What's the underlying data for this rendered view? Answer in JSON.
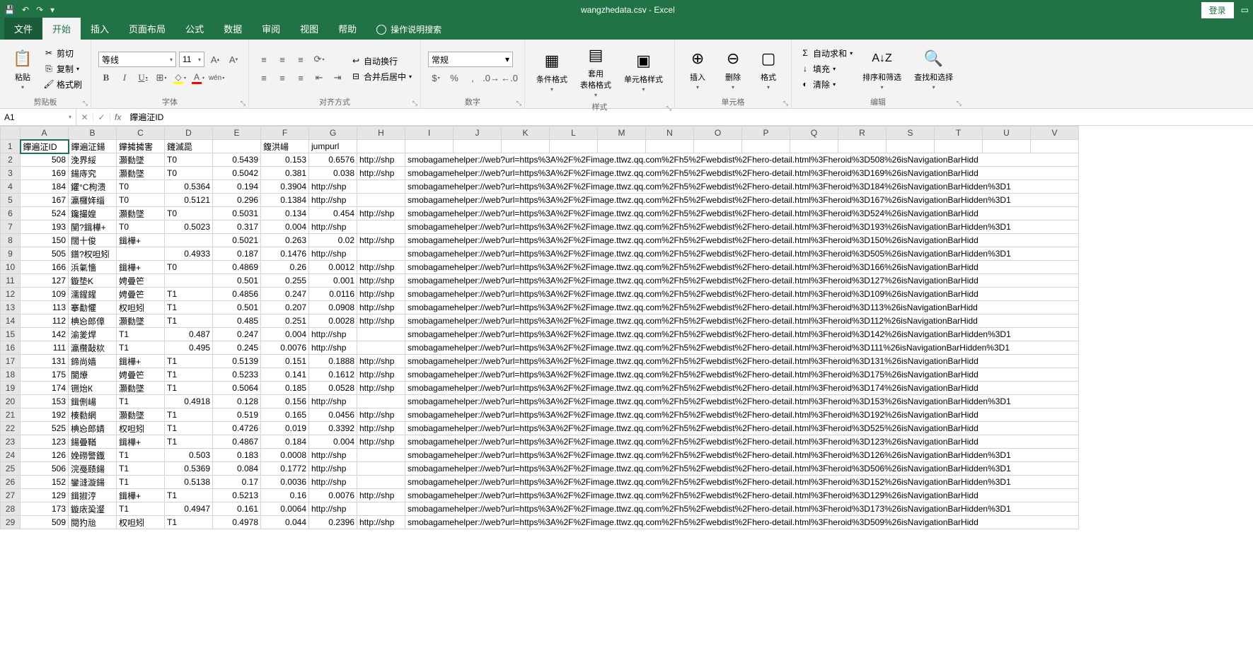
{
  "title": "wangzhedata.csv - Excel",
  "login": "登录",
  "qat": {
    "save": "💾",
    "undo": "↶",
    "redo": "↷",
    "more": "▾"
  },
  "tabs": {
    "file": "文件",
    "home": "开始",
    "insert": "插入",
    "layout": "页面布局",
    "formulas": "公式",
    "data": "数据",
    "review": "审阅",
    "view": "视图",
    "help": "帮助",
    "tellme": "操作说明搜索"
  },
  "ribbon": {
    "clipboard": {
      "label": "剪贴板",
      "paste": "粘贴",
      "cut": "剪切",
      "copy": "复制",
      "painter": "格式刷"
    },
    "font": {
      "label": "字体",
      "name": "等线",
      "size": "11"
    },
    "align": {
      "label": "对齐方式",
      "wrap": "自动换行",
      "merge": "合并后居中"
    },
    "number": {
      "label": "数字",
      "format": "常规"
    },
    "styles": {
      "label": "样式",
      "cond": "条件格式",
      "table": "套用\n表格格式",
      "cell": "单元格样式"
    },
    "cells": {
      "label": "单元格",
      "insert": "插入",
      "delete": "删除",
      "format": "格式"
    },
    "editing": {
      "label": "编辑",
      "sum": "自动求和",
      "fill": "填充",
      "clear": "清除",
      "sort": "排序和筛选",
      "find": "查找和选择"
    }
  },
  "namebox": "A1",
  "formula": "鑻遍泟ID",
  "columns": [
    "A",
    "B",
    "C",
    "D",
    "E",
    "F",
    "G",
    "H",
    "I",
    "J",
    "K",
    "L",
    "M",
    "N",
    "O",
    "P",
    "Q",
    "R",
    "S",
    "T",
    "U",
    "V"
  ],
  "headers": {
    "A": "鑻遍泟ID",
    "B": "鑻遍泟鍚",
    "C": "鑻㩀㩀害",
    "D": "鑳滅巼",
    "E": "",
    "F": "鍑洪崵",
    "G": "jumpurl"
  },
  "rows": [
    {
      "n": 1,
      "A": "鑻遍泟ID",
      "B": "鑻遍泟鍚",
      "C": "鑻㩀㩀害",
      "D": "鑳滅巼",
      "E": "",
      "F": "鍑洪崵",
      "G": "jumpurl",
      "hdr": true
    },
    {
      "n": 2,
      "A": 508,
      "B": "浼界綏",
      "C": "灝勬墜",
      "D": "T0",
      "E": 0.5439,
      "F": 0.153,
      "G": 0.6576,
      "H": "http://shp",
      "url": "smobagamehelper://web?url=https%3A%2F%2Fimage.ttwz.qq.com%2Fh5%2Fwebdist%2Fhero-detail.html%3Fheroid%3D508%26isNavigationBarHidd"
    },
    {
      "n": 3,
      "A": 169,
      "B": "鍚庤究",
      "C": "灝勬墜",
      "D": "T0",
      "E": 0.5042,
      "F": 0.381,
      "G": 0.038,
      "H": "http://shp",
      "url": "smobagamehelper://web?url=https%3A%2F%2Fimage.ttwz.qq.com%2Fh5%2Fwebdist%2Fhero-detail.html%3Fheroid%3D169%26isNavigationBarHidd"
    },
    {
      "n": 4,
      "A": 184,
      "B": "鑺°C枸溃",
      "C": "T0",
      "D": 0.5364,
      "E": 0.194,
      "F": 0.3904,
      "G": "http://shp",
      "url": "smobagamehelper://web?url=https%3A%2F%2Fimage.ttwz.qq.com%2Fh5%2Fwebdist%2Fhero-detail.html%3Fheroid%3D184%26isNavigationBarHidden%3D1"
    },
    {
      "n": 5,
      "A": 167,
      "B": "瀛欏姩缁",
      "C": "T0",
      "D": 0.5121,
      "E": 0.296,
      "F": 0.1384,
      "G": "http://shp",
      "url": "smobagamehelper://web?url=https%3A%2F%2Fimage.ttwz.qq.com%2Fh5%2Fwebdist%2Fhero-detail.html%3Fheroid%3D167%26isNavigationBarHidden%3D1"
    },
    {
      "n": 6,
      "A": 524,
      "B": "鑱撮媓",
      "C": "灝勬墜",
      "D": "T0",
      "E": 0.5031,
      "F": 0.134,
      "G": 0.454,
      "H": "http://shp",
      "url": "smobagamehelper://web?url=https%3A%2F%2Fimage.ttwz.qq.com%2Fh5%2Fwebdist%2Fhero-detail.html%3Fheroid%3D524%26isNavigationBarHidd"
    },
    {
      "n": 7,
      "A": 193,
      "B": "閺?鍓樺+",
      "C": "T0",
      "D": 0.5023,
      "E": 0.317,
      "F": 0.004,
      "G": "http://shp",
      "url": "smobagamehelper://web?url=https%3A%2F%2Fimage.ttwz.qq.com%2Fh5%2Fwebdist%2Fhero-detail.html%3Fheroid%3D193%26isNavigationBarHidden%3D1"
    },
    {
      "n": 8,
      "A": 150,
      "B": "闊十俊",
      "C": "鍓樺+",
      "D": "",
      "E": 0.5021,
      "F": 0.263,
      "G": 0.02,
      "H": "http://shp",
      "url": "smobagamehelper://web?url=https%3A%2F%2Fimage.ttwz.qq.com%2Fh5%2Fwebdist%2Fhero-detail.html%3Fheroid%3D150%26isNavigationBarHidd"
    },
    {
      "n": 9,
      "A": 505,
      "B": "鐠?权呾矧",
      "C": "",
      "D": 0.4933,
      "E": 0.187,
      "F": 0.1476,
      "G": "http://shp",
      "url": "smobagamehelper://web?url=https%3A%2F%2Fimage.ttwz.qq.com%2Fh5%2Fwebdist%2Fhero-detail.html%3Fheroid%3D505%26isNavigationBarHidden%3D1"
    },
    {
      "n": 10,
      "A": 166,
      "B": "浜氭懎",
      "C": "鍓樺+",
      "D": "T0",
      "E": 0.4869,
      "F": 0.26,
      "G": 0.0012,
      "H": "http://shp",
      "url": "smobagamehelper://web?url=https%3A%2F%2Fimage.ttwz.qq.com%2Fh5%2Fwebdist%2Fhero-detail.html%3Fheroid%3D166%26isNavigationBarHidd"
    },
    {
      "n": 11,
      "A": 127,
      "B": "鏇垫K",
      "C": "娉曡笀",
      "D": "",
      "E": 0.501,
      "F": 0.255,
      "G": 0.001,
      "H": "http://shp",
      "url": "smobagamehelper://web?url=https%3A%2F%2Fimage.ttwz.qq.com%2Fh5%2Fwebdist%2Fhero-detail.html%3Fheroid%3D127%26isNavigationBarHidd"
    },
    {
      "n": 12,
      "A": 109,
      "B": "濡鍟鍟",
      "C": "娉曡笀",
      "D": "T1",
      "E": 0.4856,
      "F": 0.247,
      "G": 0.0116,
      "H": "http://shp",
      "url": "smobagamehelper://web?url=https%3A%2F%2Fimage.ttwz.qq.com%2Fh5%2Fwebdist%2Fhero-detail.html%3Fheroid%3D109%26isNavigationBarHidd"
    },
    {
      "n": 13,
      "A": 113,
      "B": "搴勫懼",
      "C": "权呾矧",
      "D": "T1",
      "E": 0.501,
      "F": 0.207,
      "G": 0.0908,
      "H": "http://shp",
      "url": "smobagamehelper://web?url=https%3A%2F%2Fimage.ttwz.qq.com%2Fh5%2Fwebdist%2Fhero-detail.html%3Fheroid%3D113%26isNavigationBarHidd"
    },
    {
      "n": 14,
      "A": 112,
      "B": "椣㤀郎傽",
      "C": "灝勬墜",
      "D": "T1",
      "E": 0.485,
      "F": 0.251,
      "G": 0.0028,
      "H": "http://shp",
      "url": "smobagamehelper://web?url=https%3A%2F%2Fimage.ttwz.qq.com%2Fh5%2Fwebdist%2Fhero-detail.html%3Fheroid%3D112%26isNavigationBarHidd"
    },
    {
      "n": 15,
      "A": 142,
      "B": "渝夎焊",
      "C": "T1",
      "D": 0.487,
      "E": 0.247,
      "F": 0.004,
      "G": "http://shp",
      "url": "smobagamehelper://web?url=https%3A%2F%2Fimage.ttwz.qq.com%2Fh5%2Fwebdist%2Fhero-detail.html%3Fheroid%3D142%26isNavigationBarHidden%3D1"
    },
    {
      "n": 16,
      "A": 111,
      "B": "瀛欑敮栨",
      "C": "T1",
      "D": 0.495,
      "E": 0.245,
      "F": 0.0076,
      "G": "http://shp",
      "url": "smobagamehelper://web?url=https%3A%2F%2Fimage.ttwz.qq.com%2Fh5%2Fwebdist%2Fhero-detail.html%3Fheroid%3D111%26isNavigationBarHidden%3D1"
    },
    {
      "n": 17,
      "A": 131,
      "B": "鍗尚嫱",
      "C": "鍓樺+",
      "D": "T1",
      "E": 0.5139,
      "F": 0.151,
      "G": 0.1888,
      "H": "http://shp",
      "url": "smobagamehelper://web?url=https%3A%2F%2Fimage.ttwz.qq.com%2Fh5%2Fwebdist%2Fhero-detail.html%3Fheroid%3D131%26isNavigationBarHidd"
    },
    {
      "n": 18,
      "A": 175,
      "B": "閬爎",
      "C": "娉曡笀",
      "D": "T1",
      "E": 0.5233,
      "F": 0.141,
      "G": 0.1612,
      "H": "http://shp",
      "url": "smobagamehelper://web?url=https%3A%2F%2Fimage.ttwz.qq.com%2Fh5%2Fwebdist%2Fhero-detail.html%3Fheroid%3D175%26isNavigationBarHidd"
    },
    {
      "n": 19,
      "A": 174,
      "B": "铏炲К",
      "C": "灝勬墜",
      "D": "T1",
      "E": 0.5064,
      "F": 0.185,
      "G": 0.0528,
      "H": "http://shp",
      "url": "smobagamehelper://web?url=https%3A%2F%2Fimage.ttwz.qq.com%2Fh5%2Fwebdist%2Fhero-detail.html%3Fheroid%3D174%26isNavigationBarHidd"
    },
    {
      "n": 20,
      "A": 153,
      "B": "鍓侀崵",
      "C": "T1",
      "D": 0.4918,
      "E": 0.128,
      "F": 0.156,
      "G": "http://shp",
      "url": "smobagamehelper://web?url=https%3A%2F%2Fimage.ttwz.qq.com%2Fh5%2Fwebdist%2Fhero-detail.html%3Fheroid%3D153%26isNavigationBarHidden%3D1"
    },
    {
      "n": 21,
      "A": 192,
      "B": "楱勬網",
      "C": "灝勬墜",
      "D": "T1",
      "E": 0.519,
      "F": 0.165,
      "G": 0.0456,
      "H": "http://shp",
      "url": "smobagamehelper://web?url=https%3A%2F%2Fimage.ttwz.qq.com%2Fh5%2Fwebdist%2Fhero-detail.html%3Fheroid%3D192%26isNavigationBarHidd"
    },
    {
      "n": 22,
      "A": 525,
      "B": "椣㤀郎婧",
      "C": "权呾矧",
      "D": "T1",
      "E": 0.4726,
      "F": 0.019,
      "G": 0.3392,
      "H": "http://shp",
      "url": "smobagamehelper://web?url=https%3A%2F%2Fimage.ttwz.qq.com%2Fh5%2Fwebdist%2Fhero-detail.html%3Fheroid%3D525%26isNavigationBarHidd"
    },
    {
      "n": 23,
      "A": 123,
      "B": "鍚曡鞧",
      "C": "鍓樺+",
      "D": "T1",
      "E": 0.4867,
      "F": 0.184,
      "G": 0.004,
      "H": "http://shp",
      "url": "smobagamehelper://web?url=https%3A%2F%2Fimage.ttwz.qq.com%2Fh5%2Fwebdist%2Fhero-detail.html%3Fheroid%3D123%26isNavigationBarHidd"
    },
    {
      "n": 24,
      "A": 126,
      "B": "娩磱警鐡",
      "C": "T1",
      "D": 0.503,
      "E": 0.183,
      "F": 0.0008,
      "G": "http://shp",
      "url": "smobagamehelper://web?url=https%3A%2F%2Fimage.ttwz.qq.com%2Fh5%2Fwebdist%2Fhero-detail.html%3Fheroid%3D126%26isNavigationBarHidden%3D1"
    },
    {
      "n": 25,
      "A": 506,
      "B": "浣戞赜鍚",
      "C": "T1",
      "D": 0.5369,
      "E": 0.084,
      "F": 0.1772,
      "G": "http://shp",
      "url": "smobagamehelper://web?url=https%3A%2F%2Fimage.ttwz.qq.com%2Fh5%2Fwebdist%2Fhero-detail.html%3Fheroid%3D506%26isNavigationBarHidden%3D1"
    },
    {
      "n": 26,
      "A": 152,
      "B": "鑾漨漩鍚",
      "C": "T1",
      "D": 0.5138,
      "E": 0.17,
      "F": 0.0036,
      "G": "http://shp",
      "url": "smobagamehelper://web?url=https%3A%2F%2Fimage.ttwz.qq.com%2Fh5%2Fwebdist%2Fhero-detail.html%3Fheroid%3D152%26isNavigationBarHidden%3D1"
    },
    {
      "n": 27,
      "A": 129,
      "B": "鍓掓涥",
      "C": "鍓樺+",
      "D": "T1",
      "E": 0.5213,
      "F": 0.16,
      "G": 0.0076,
      "H": "http://shp",
      "url": "smobagamehelper://web?url=https%3A%2F%2Fimage.ttwz.qq.com%2Fh5%2Fwebdist%2Fhero-detail.html%3Fheroid%3D129%26isNavigationBarHidd"
    },
    {
      "n": 28,
      "A": 173,
      "B": "鏇庡巬瀣",
      "C": "T1",
      "D": 0.4947,
      "E": 0.161,
      "F": 0.0064,
      "G": "http://shp",
      "url": "smobagamehelper://web?url=https%3A%2F%2Fimage.ttwz.qq.com%2Fh5%2Fwebdist%2Fhero-detail.html%3Fheroid%3D173%26isNavigationBarHidden%3D1"
    },
    {
      "n": 29,
      "A": 509,
      "B": "閱犳兘",
      "C": "权呾矧",
      "D": "T1",
      "E": 0.4978,
      "F": 0.044,
      "G": 0.2396,
      "H": "http://shp",
      "url": "smobagamehelper://web?url=https%3A%2F%2Fimage.ttwz.qq.com%2Fh5%2Fwebdist%2Fhero-detail.html%3Fheroid%3D509%26isNavigationBarHidd"
    }
  ]
}
